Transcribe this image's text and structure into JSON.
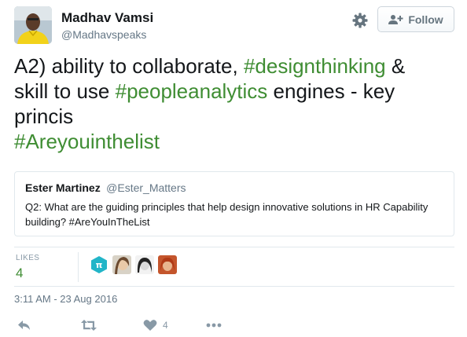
{
  "tweet": {
    "author": {
      "name": "Madhav Vamsi",
      "handle": "@Madhavspeaks",
      "avatar_icon": "person-avatar"
    },
    "follow_button": {
      "label": "Follow",
      "icon": "person-plus-icon"
    },
    "settings_icon": "gear-icon",
    "text": {
      "line1_a": "A2) ability to collaborate, ",
      "line1_hashtag": "#designthinking",
      "line1_b": " &",
      "line2_a": "skill to use ",
      "line2_hashtag": "#peopleanalytics",
      "line2_b": " engines - key",
      "line3": "princis",
      "line4_hashtag": "#Areyouinthelist"
    },
    "quoted_tweet": {
      "name": "Ester Martinez",
      "handle": "@Ester_Matters",
      "text": "Q2: What are the guiding principles that help design innovative solutions in HR Capability building? #AreYouInTheList"
    },
    "stats": {
      "likes_label": "LIKES",
      "likes_count": "4",
      "liker_avatars": [
        "liker-avatar-1",
        "liker-avatar-2",
        "liker-avatar-3",
        "liker-avatar-4"
      ]
    },
    "timestamp": "3:11 AM - 23 Aug 2016",
    "actions": {
      "reply_icon": "reply-icon",
      "retweet_icon": "retweet-icon",
      "like_icon": "heart-icon",
      "like_count": "4",
      "more_icon": "more-dots-icon"
    },
    "colors": {
      "hashtag": "#3f8d33",
      "text": "#14171a",
      "secondary": "#657786",
      "border": "#e1e8ed",
      "icon": "#8899a6"
    }
  }
}
